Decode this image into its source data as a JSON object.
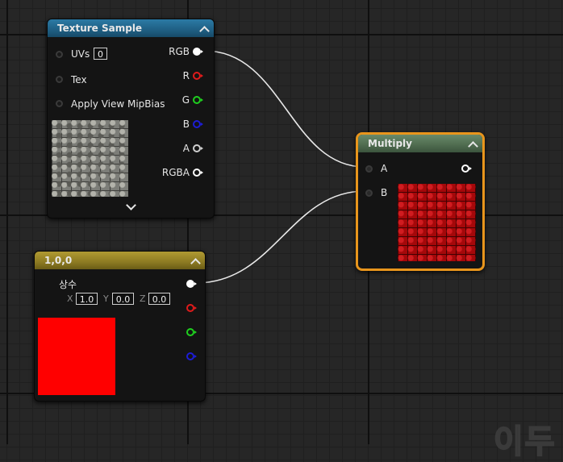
{
  "texture_sample": {
    "title": "Texture Sample",
    "inputs": [
      {
        "label": "UVs",
        "value": "0"
      },
      {
        "label": "Tex"
      },
      {
        "label": "Apply View MipBias"
      }
    ],
    "outputs": [
      {
        "label": "RGB",
        "color": "#ffffff"
      },
      {
        "label": "R",
        "color": "#e01b1b"
      },
      {
        "label": "G",
        "color": "#1fd01f"
      },
      {
        "label": "B",
        "color": "#1d1dd6"
      },
      {
        "label": "A",
        "color": "#cfcfcf"
      },
      {
        "label": "RGBA",
        "color": "#ffffff"
      }
    ],
    "header_color": "#1f5f83"
  },
  "multiply": {
    "title": "Multiply",
    "inputs": [
      {
        "label": "A"
      },
      {
        "label": "B"
      }
    ],
    "header_color": "#4e6b4f",
    "highlight_color": "#e8951c"
  },
  "constant": {
    "title": "1,0,0",
    "label": "상수",
    "x_label": "X",
    "x_value": "1.0",
    "y_label": "Y",
    "y_value": "0.0",
    "z_label": "Z",
    "z_value": "0.0",
    "output_colors": [
      "#ffffff",
      "#e01b1b",
      "#1fd01f",
      "#1d1dd6"
    ],
    "header_color": "#8c7a22",
    "swatch_color": "#ff0000"
  },
  "watermark": "이두"
}
